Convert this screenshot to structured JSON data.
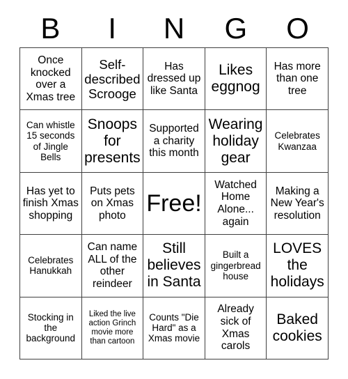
{
  "card": {
    "title": "BINGO",
    "header_letters": [
      "B",
      "I",
      "N",
      "G",
      "O"
    ],
    "grid_size": "5x5",
    "free_space_label": "Free!",
    "border_color": "#3f3f3f",
    "text_color": "#000000",
    "background_color": "#ffffff"
  },
  "squares": [
    {
      "text": "Once knocked over a Xmas tree",
      "size": "md"
    },
    {
      "text": "Self-described Scrooge",
      "size": "lg"
    },
    {
      "text": "Has dressed up like Santa",
      "size": "md"
    },
    {
      "text": "Likes eggnog",
      "size": "xl"
    },
    {
      "text": "Has more than one tree",
      "size": "md"
    },
    {
      "text": "Can whistle 15 seconds of Jingle Bells",
      "size": "sm"
    },
    {
      "text": "Snoops for presents",
      "size": "xl"
    },
    {
      "text": "Supported a charity this month",
      "size": "md"
    },
    {
      "text": "Wearing holiday gear",
      "size": "xl"
    },
    {
      "text": "Celebrates Kwanzaa",
      "size": "sm"
    },
    {
      "text": "Has yet to finish Xmas shopping",
      "size": "md"
    },
    {
      "text": "Puts pets on Xmas photo",
      "size": "md"
    },
    {
      "text": "Free!",
      "size": "free"
    },
    {
      "text": "Watched Home Alone... again",
      "size": "md"
    },
    {
      "text": "Making a New Year's resolution",
      "size": "md"
    },
    {
      "text": "Celebrates Hanukkah",
      "size": "sm"
    },
    {
      "text": "Can name ALL of the other reindeer",
      "size": "md"
    },
    {
      "text": "Still believes in Santa",
      "size": "xl"
    },
    {
      "text": "Built a gingerbread house",
      "size": "sm"
    },
    {
      "text": "LOVES the holidays",
      "size": "xl"
    },
    {
      "text": "Stocking in the background",
      "size": "sm"
    },
    {
      "text": "Liked the live action Grinch movie more than cartoon",
      "size": "xs"
    },
    {
      "text": "Counts \"Die Hard\" as a Xmas movie",
      "size": "sm"
    },
    {
      "text": "Already sick of Xmas carols",
      "size": "md"
    },
    {
      "text": "Baked cookies",
      "size": "xl"
    }
  ]
}
